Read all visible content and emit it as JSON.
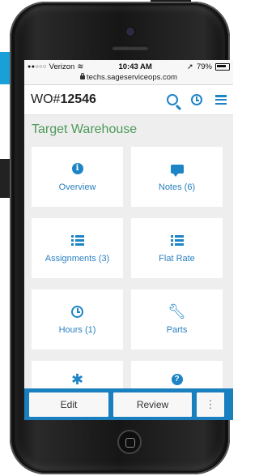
{
  "status_bar": {
    "carrier": "Verizon",
    "time": "10:43 AM",
    "battery": "79%",
    "url": "techs.sageserviceops.com"
  },
  "app_bar": {
    "wo_prefix": "WO#",
    "wo_number": "12546",
    "icons": [
      "search-icon",
      "clock-icon",
      "menu-icon"
    ]
  },
  "customer": "Target Warehouse",
  "tiles": [
    {
      "label": "Overview",
      "icon": "info-icon"
    },
    {
      "label": "Notes (6)",
      "icon": "comment-icon"
    },
    {
      "label": "Assignments (3)",
      "icon": "list-icon"
    },
    {
      "label": "Flat Rate",
      "icon": "list-icon"
    },
    {
      "label": "Hours (1)",
      "icon": "clock-icon"
    },
    {
      "label": "Parts",
      "icon": "wrench-icon"
    },
    {
      "label": "",
      "icon": "asterisk-icon"
    },
    {
      "label": "",
      "icon": "question-icon"
    }
  ],
  "bottom_bar": {
    "edit_label": "Edit",
    "review_label": "Review",
    "more_label": "⋮"
  },
  "colors": {
    "accent": "#1d84c6",
    "customer_green": "#4d9a5a",
    "bottom_bar": "#1a7fbf"
  }
}
